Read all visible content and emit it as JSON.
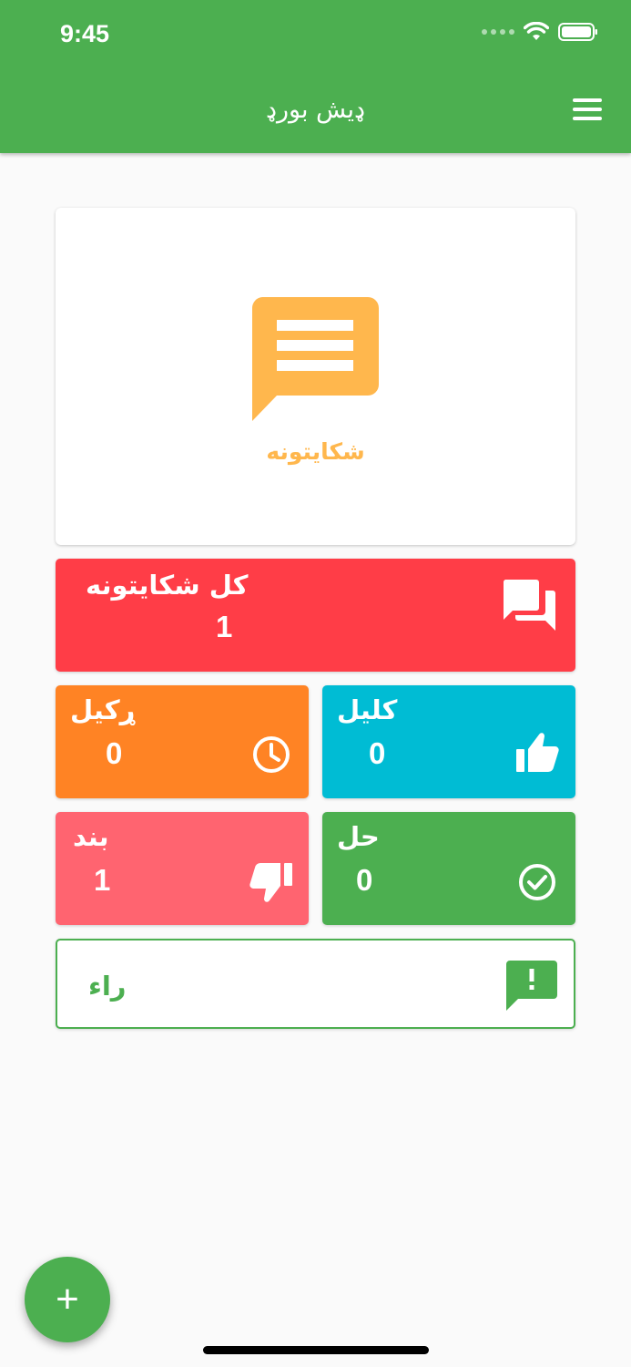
{
  "status_bar": {
    "time": "9:45"
  },
  "appbar": {
    "title": "ډیش بورډ",
    "menu_icon": "menu-icon"
  },
  "hero": {
    "label": "شکایتونه",
    "icon": "chat-message-icon",
    "color": "#ffb74d"
  },
  "tiles": {
    "all": {
      "label": "کل شکایتونه",
      "value": "1",
      "icon": "forum-icon",
      "color": "#ff3d47"
    },
    "pending": {
      "label": "ړکيل",
      "value": "0",
      "icon": "clock-icon",
      "color": "#ff8324"
    },
    "seen": {
      "label": "کلیل",
      "value": "0",
      "icon": "thumb-up-icon",
      "color": "#00bcd4"
    },
    "closed": {
      "label": "بند",
      "value": "1",
      "icon": "thumb-down-icon",
      "color": "#ff6470"
    },
    "solved": {
      "label": "حل",
      "value": "0",
      "icon": "check-circle-icon",
      "color": "#4caf50"
    }
  },
  "opinion": {
    "label": "راء",
    "icon": "feedback-icon",
    "color": "#4caf50"
  },
  "fab": {
    "label": "+",
    "icon": "add-icon"
  }
}
